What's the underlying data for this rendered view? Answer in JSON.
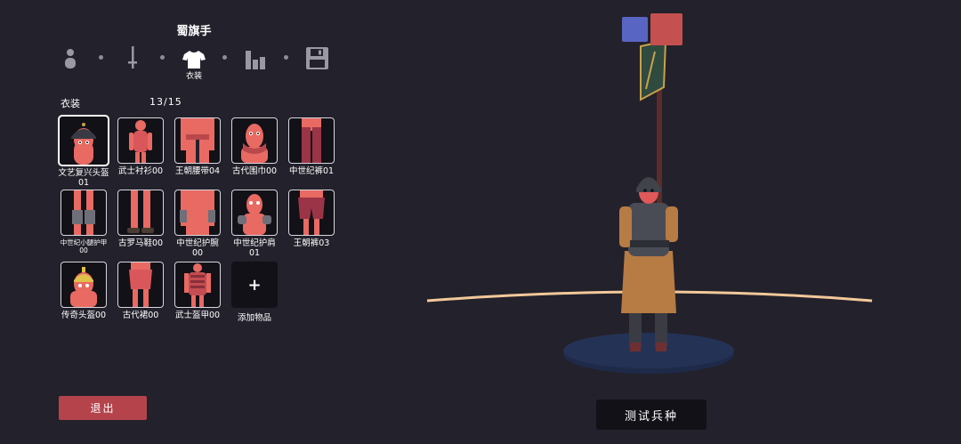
{
  "unit_name": "蜀旗手",
  "steps": [
    {
      "icon": "person-icon"
    },
    {
      "icon": "sword-icon"
    },
    {
      "icon": "shirt-icon",
      "label": "衣装",
      "active": true
    },
    {
      "icon": "stats-icon"
    },
    {
      "icon": "save-icon"
    }
  ],
  "section": {
    "title": "衣装",
    "count": "13/15"
  },
  "items": [
    {
      "label": "文艺复兴头盔01",
      "selected": true
    },
    {
      "label": "武士衬衫00"
    },
    {
      "label": "王朝腰带04"
    },
    {
      "label": "古代围巾00"
    },
    {
      "label": "中世纪裤01"
    },
    {
      "label": "中世纪小腿护甲00"
    },
    {
      "label": "古罗马鞋00"
    },
    {
      "label": "中世纪护腕00"
    },
    {
      "label": "中世纪护肩01"
    },
    {
      "label": "王朝裤03"
    },
    {
      "label": "传奇头盔00"
    },
    {
      "label": "古代裙00"
    },
    {
      "label": "武士盔甲00"
    }
  ],
  "add_item": {
    "symbol": "+",
    "label": "添加物品"
  },
  "buttons": {
    "exit": "退出",
    "test_unit": "测试兵种"
  },
  "team_colors": {
    "blue": "#5865c2",
    "red": "#c4504f"
  }
}
